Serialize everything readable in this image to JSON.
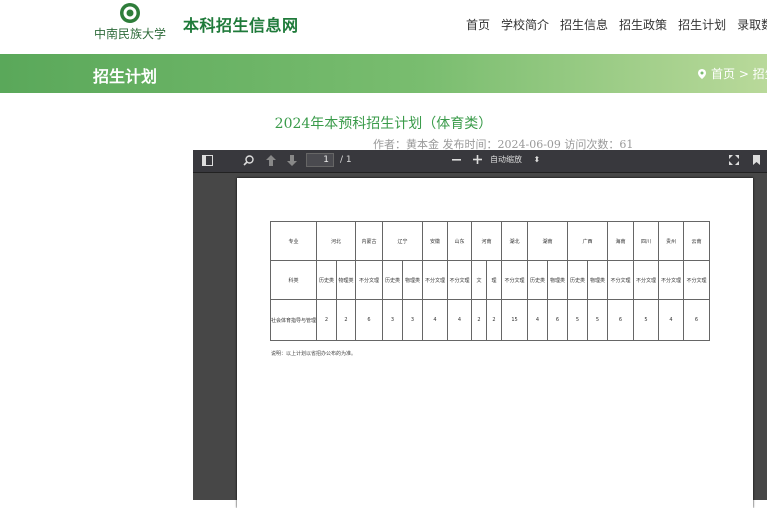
{
  "header": {
    "logo_text": "中南民族大学",
    "site_title": "本科招生信息网",
    "nav": [
      "首页",
      "学校简介",
      "招生信息",
      "招生政策",
      "招生计划",
      "录取数据"
    ]
  },
  "band": {
    "title": "招生计划",
    "breadcrumb": "首页 >  招生"
  },
  "article": {
    "title": "2024年本预科招生计划（体育类）",
    "meta": "作者：黄本金 发布时间：2024-06-09 访问次数：61"
  },
  "viewer": {
    "page_current": "1",
    "page_total": "/ 1",
    "zoom": "自动缩放",
    "colors": {
      "toolbar": "#38383d",
      "bg": "#474747"
    }
  },
  "table": {
    "header_label": "专业",
    "provinces": [
      "河北",
      "内蒙古",
      "辽宁",
      "安徽",
      "山东",
      "河南",
      "湖北",
      "湖南",
      "广西",
      "海南",
      "四川",
      "贵州",
      "云南"
    ],
    "subject_label": "科类",
    "subjects": [
      "历史类",
      "物理类",
      "不分文理",
      "历史类",
      "物理类",
      "不分文理",
      "不分文理",
      "文",
      "理",
      "不分文理",
      "历史类",
      "物理类",
      "历史类",
      "物理类",
      "不分文理",
      "不分文理",
      "不分文理",
      "不分文理"
    ],
    "major": "社会体育指导与管理",
    "counts": [
      "2",
      "2",
      "6",
      "3",
      "3",
      "4",
      "4",
      "2",
      "2",
      "15",
      "4",
      "6",
      "5",
      "5",
      "6",
      "5",
      "4",
      "6"
    ],
    "note": "说明：以上计划以省招办公布的为准。"
  }
}
